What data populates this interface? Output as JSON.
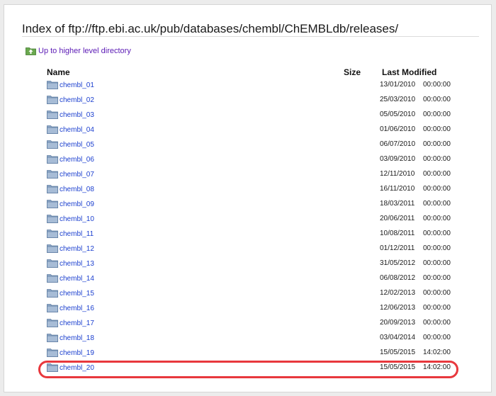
{
  "page": {
    "title": "Index of ftp://ftp.ebi.ac.uk/pub/databases/chembl/ChEMBLdb/releases/",
    "up_link": "Up to higher level directory"
  },
  "columns": {
    "name": "Name",
    "size": "Size",
    "modified": "Last Modified"
  },
  "colors": {
    "link": "#1b3fcf",
    "up_link": "#5b1ab5",
    "highlight": "#e8383d",
    "folder": "#7f9bbd"
  },
  "rows": [
    {
      "name": "chembl_01",
      "date": "13/01/2010",
      "time": "00:00:00"
    },
    {
      "name": "chembl_02",
      "date": "25/03/2010",
      "time": "00:00:00"
    },
    {
      "name": "chembl_03",
      "date": "05/05/2010",
      "time": "00:00:00"
    },
    {
      "name": "chembl_04",
      "date": "01/06/2010",
      "time": "00:00:00"
    },
    {
      "name": "chembl_05",
      "date": "06/07/2010",
      "time": "00:00:00"
    },
    {
      "name": "chembl_06",
      "date": "03/09/2010",
      "time": "00:00:00"
    },
    {
      "name": "chembl_07",
      "date": "12/11/2010",
      "time": "00:00:00"
    },
    {
      "name": "chembl_08",
      "date": "16/11/2010",
      "time": "00:00:00"
    },
    {
      "name": "chembl_09",
      "date": "18/03/2011",
      "time": "00:00:00"
    },
    {
      "name": "chembl_10",
      "date": "20/06/2011",
      "time": "00:00:00"
    },
    {
      "name": "chembl_11",
      "date": "10/08/2011",
      "time": "00:00:00"
    },
    {
      "name": "chembl_12",
      "date": "01/12/2011",
      "time": "00:00:00"
    },
    {
      "name": "chembl_13",
      "date": "31/05/2012",
      "time": "00:00:00"
    },
    {
      "name": "chembl_14",
      "date": "06/08/2012",
      "time": "00:00:00"
    },
    {
      "name": "chembl_15",
      "date": "12/02/2013",
      "time": "00:00:00"
    },
    {
      "name": "chembl_16",
      "date": "12/06/2013",
      "time": "00:00:00"
    },
    {
      "name": "chembl_17",
      "date": "20/09/2013",
      "time": "00:00:00"
    },
    {
      "name": "chembl_18",
      "date": "03/04/2014",
      "time": "00:00:00"
    },
    {
      "name": "chembl_19",
      "date": "15/05/2015",
      "time": "14:02:00"
    },
    {
      "name": "chembl_20",
      "date": "15/05/2015",
      "time": "14:02:00"
    }
  ]
}
